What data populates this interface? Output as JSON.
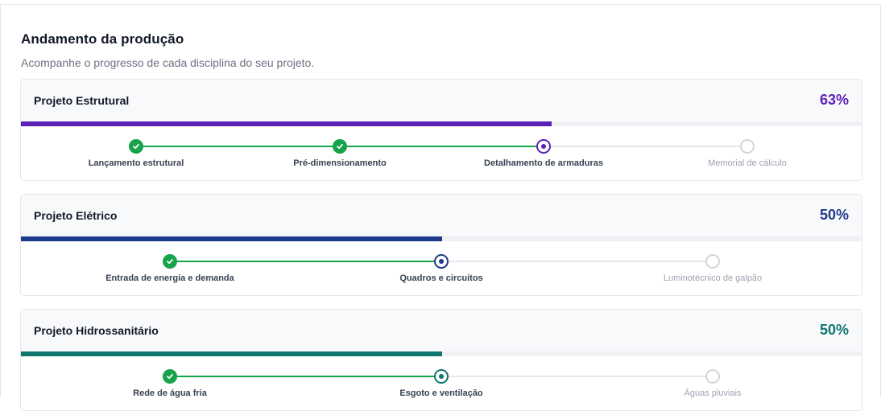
{
  "header": {
    "title": "Andamento da produção",
    "subtitle": "Acompanhe o progresso de cada disciplina do seu projeto."
  },
  "disciplines": [
    {
      "name": "Projeto Estrutural",
      "percent_label": "63%",
      "progress": 0.63,
      "color": "#5b21b6",
      "steps": [
        {
          "label": "Lançamento estrutural",
          "status": "done"
        },
        {
          "label": "Pré-dimensionamento",
          "status": "done"
        },
        {
          "label": "Detalhamento de armaduras",
          "status": "current"
        },
        {
          "label": "Memorial de cálculo",
          "status": "todo"
        }
      ]
    },
    {
      "name": "Projeto Elétrico",
      "percent_label": "50%",
      "progress": 0.5,
      "color": "#1e3a8a",
      "steps": [
        {
          "label": "Entrada de energia e demanda",
          "status": "done"
        },
        {
          "label": "Quadros e circuitos",
          "status": "current"
        },
        {
          "label": "Luminotécnico de galpão",
          "status": "todo"
        }
      ]
    },
    {
      "name": "Projeto Hidrossanitário",
      "percent_label": "50%",
      "progress": 0.5,
      "color": "#0f766e",
      "steps": [
        {
          "label": "Rede de água fria",
          "status": "done"
        },
        {
          "label": "Esgoto e ventilação",
          "status": "current"
        },
        {
          "label": "Águas pluviais",
          "status": "todo"
        }
      ]
    }
  ],
  "icons": {
    "done": "check-icon",
    "current": "current-dot-icon",
    "todo": "empty-circle-icon"
  }
}
